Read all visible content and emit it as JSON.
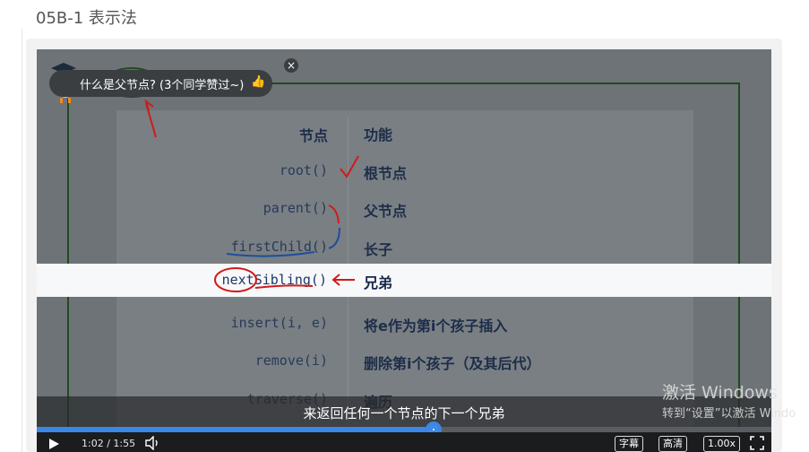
{
  "page": {
    "title": "05B-1 表示法"
  },
  "popup": {
    "question": "什么是父节点? (3个同学赞过~)",
    "close_label": "×"
  },
  "slide": {
    "table_header": {
      "code": "节点",
      "func": "功能"
    },
    "rows": [
      {
        "code": "root()",
        "func": "根节点"
      },
      {
        "code": "parent()",
        "func": "父节点"
      },
      {
        "code": "firstChild()",
        "func": "长子"
      },
      {
        "code": "nextSibling()",
        "func": "兄弟"
      },
      {
        "code": "insert(i, e)",
        "func": "将e作为第i个孩子插入"
      },
      {
        "code": "remove(i)",
        "func": "删除第i个孩子（及其后代）"
      },
      {
        "code": "traverse()",
        "func": "遍历"
      }
    ]
  },
  "subtitle": {
    "text": "来返回任何一个节点的下一个兄弟"
  },
  "player": {
    "time": "1:02 / 1:55",
    "progress": 0.54,
    "buttons": {
      "subtitles": "字幕",
      "quality": "高清",
      "speed": "1.00x"
    }
  },
  "watermark": {
    "line1": "激活 Windows",
    "line2": "转到“设置”以激活 Windo"
  },
  "colors": {
    "accent": "#3b87e6",
    "annotation_red": "#d11a1a",
    "annotation_blue": "#1a4f9c"
  }
}
